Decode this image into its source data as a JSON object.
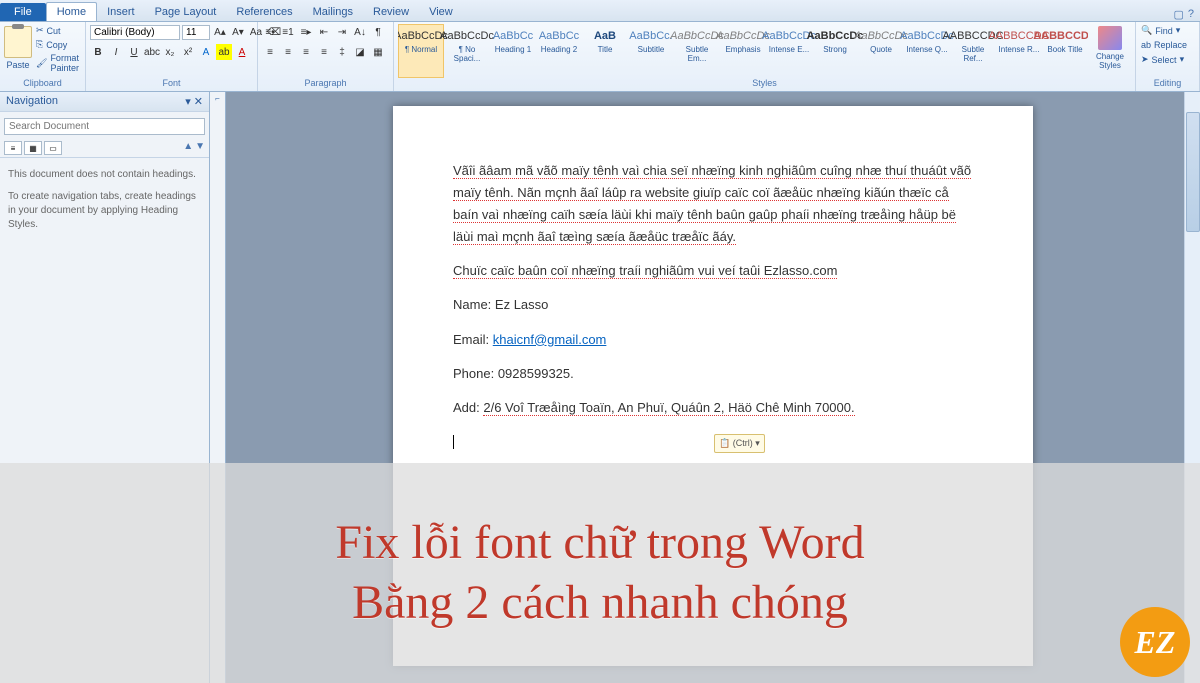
{
  "tabs": {
    "file": "File",
    "items": [
      "Home",
      "Insert",
      "Page Layout",
      "References",
      "Mailings",
      "Review",
      "View"
    ],
    "active_index": 0
  },
  "clipboard": {
    "paste": "Paste",
    "cut": "Cut",
    "copy": "Copy",
    "format_painter": "Format Painter",
    "label": "Clipboard"
  },
  "font": {
    "name": "Calibri (Body)",
    "size": "11",
    "label": "Font"
  },
  "paragraph": {
    "label": "Paragraph"
  },
  "styles": {
    "label": "Styles",
    "change": "Change Styles",
    "items": [
      {
        "preview": "AaBbCcDc",
        "name": "¶ Normal",
        "cls": ""
      },
      {
        "preview": "AaBbCcDc",
        "name": "¶ No Spaci...",
        "cls": ""
      },
      {
        "preview": "AaBbCc",
        "name": "Heading 1",
        "cls": "blue"
      },
      {
        "preview": "AaBbCc",
        "name": "Heading 2",
        "cls": "blue"
      },
      {
        "preview": "AaB",
        "name": "Title",
        "cls": "darkblue"
      },
      {
        "preview": "AaBbCc.",
        "name": "Subtitle",
        "cls": "blue"
      },
      {
        "preview": "AaBbCcDc",
        "name": "Subtle Em...",
        "cls": "subtle"
      },
      {
        "preview": "AaBbCcDc",
        "name": "Emphasis",
        "cls": "subtle"
      },
      {
        "preview": "AaBbCcDc",
        "name": "Intense E...",
        "cls": "blue"
      },
      {
        "preview": "AaBbCcDc",
        "name": "Strong",
        "cls": "strong"
      },
      {
        "preview": "AaBbCcDc",
        "name": "Quote",
        "cls": "subtle"
      },
      {
        "preview": "AaBbCcDc",
        "name": "Intense Q...",
        "cls": "blue"
      },
      {
        "preview": "AABBCCDC",
        "name": "Subtle Ref...",
        "cls": ""
      },
      {
        "preview": "AABBCCDC",
        "name": "Intense R...",
        "cls": "red"
      },
      {
        "preview": "AABBCCDC",
        "name": "Book Title",
        "cls": "redbold"
      }
    ]
  },
  "editing": {
    "find": "Find",
    "replace": "Replace",
    "select": "Select",
    "label": "Editing"
  },
  "nav": {
    "title": "Navigation",
    "placeholder": "Search Document",
    "empty1": "This document does not contain headings.",
    "empty2": "To create navigation tabs, create headings in your document by applying Heading Styles."
  },
  "doc": {
    "p1": "Vãîi ãâam mã vãõ maïy tênh vaì chia seï nhæïng kinh nghiãûm cuîng nhæ thuí thuáût vãõ maïy tênh. Nãn mçnh ãaî láûp ra website giuïp caïc coï ãæåüc nhæïng kiãún thæïc cå baín vaì nhæïng caïh sæía läùi khi maïy tênh baûn gaûp phaíi nhæïng træåìng håüp bë läùi maì mçnh ãaî tæìng sæía ãæåüc træåïc ãáy.",
    "p2": "Chuïc caïc baûn coï nhæïng traíi nghiãûm vui veí taûi Ezlasso.com",
    "name_label": "Name:",
    "name_value": "Ez Lasso",
    "email_label": "Email:",
    "email_value": "khaicnf@gmail.com",
    "phone_label": "Phone:",
    "phone_value": "0928599325.",
    "add_label": "Add:",
    "add_value": "2/6 Voî Træåìng Toaïn, An Phuï, Quáûn 2, Häö Chê Minh 70000.",
    "paste_opts": "(Ctrl) ▾"
  },
  "overlay": {
    "line1": "Fix lỗi font chữ trong Word",
    "line2": "Bằng 2 cách nhanh chóng",
    "badge": "EZ"
  }
}
